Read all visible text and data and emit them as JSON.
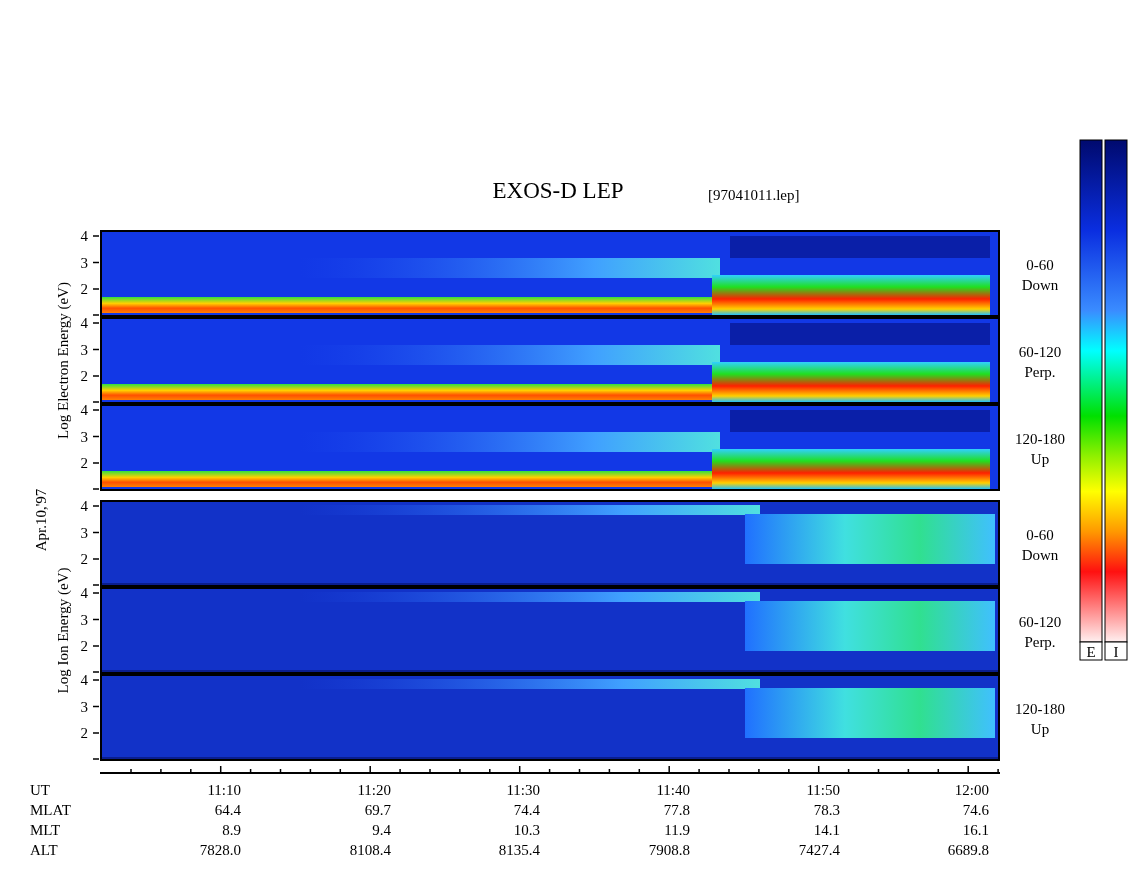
{
  "title": "EXOS-D LEP",
  "file_name": "[97041011.lep]",
  "date": "Apr.10,'97",
  "sections": [
    {
      "kind": "electron",
      "axis_label": "Log Electron Energy (eV)",
      "panels": [
        {
          "y_ticks": [
            "4",
            "3",
            "2"
          ],
          "pitch_angle": "0-60",
          "direction": "Down"
        },
        {
          "y_ticks": [
            "4",
            "3",
            "2"
          ],
          "pitch_angle": "60-120",
          "direction": "Perp."
        },
        {
          "y_ticks": [
            "4",
            "3",
            "2"
          ],
          "pitch_angle": "120-180",
          "direction": "Up"
        }
      ]
    },
    {
      "kind": "ion",
      "axis_label": "Log Ion Energy (eV)",
      "panels": [
        {
          "y_ticks": [
            "4",
            "3",
            "2"
          ],
          "pitch_angle": "0-60",
          "direction": "Down"
        },
        {
          "y_ticks": [
            "4",
            "3",
            "2"
          ],
          "pitch_angle": "60-120",
          "direction": "Perp."
        },
        {
          "y_ticks": [
            "4",
            "3",
            "2"
          ],
          "pitch_angle": "120-180",
          "direction": "Up"
        }
      ]
    }
  ],
  "colorbars": [
    {
      "label": "E"
    },
    {
      "label": "I"
    }
  ],
  "time_axis": {
    "rows": [
      {
        "label": "UT",
        "values": [
          "11:10",
          "11:20",
          "11:30",
          "11:40",
          "11:50",
          "12:00"
        ]
      },
      {
        "label": "MLAT",
        "values": [
          "64.4",
          "69.7",
          "74.4",
          "77.8",
          "78.3",
          "74.6"
        ]
      },
      {
        "label": "MLT",
        "values": [
          "8.9",
          "9.4",
          "10.3",
          "11.9",
          "14.1",
          "16.1"
        ]
      },
      {
        "label": "ALT",
        "values": [
          "7828.0",
          "8108.4",
          "8135.4",
          "7908.8",
          "7427.4",
          "6689.8"
        ]
      }
    ]
  }
}
